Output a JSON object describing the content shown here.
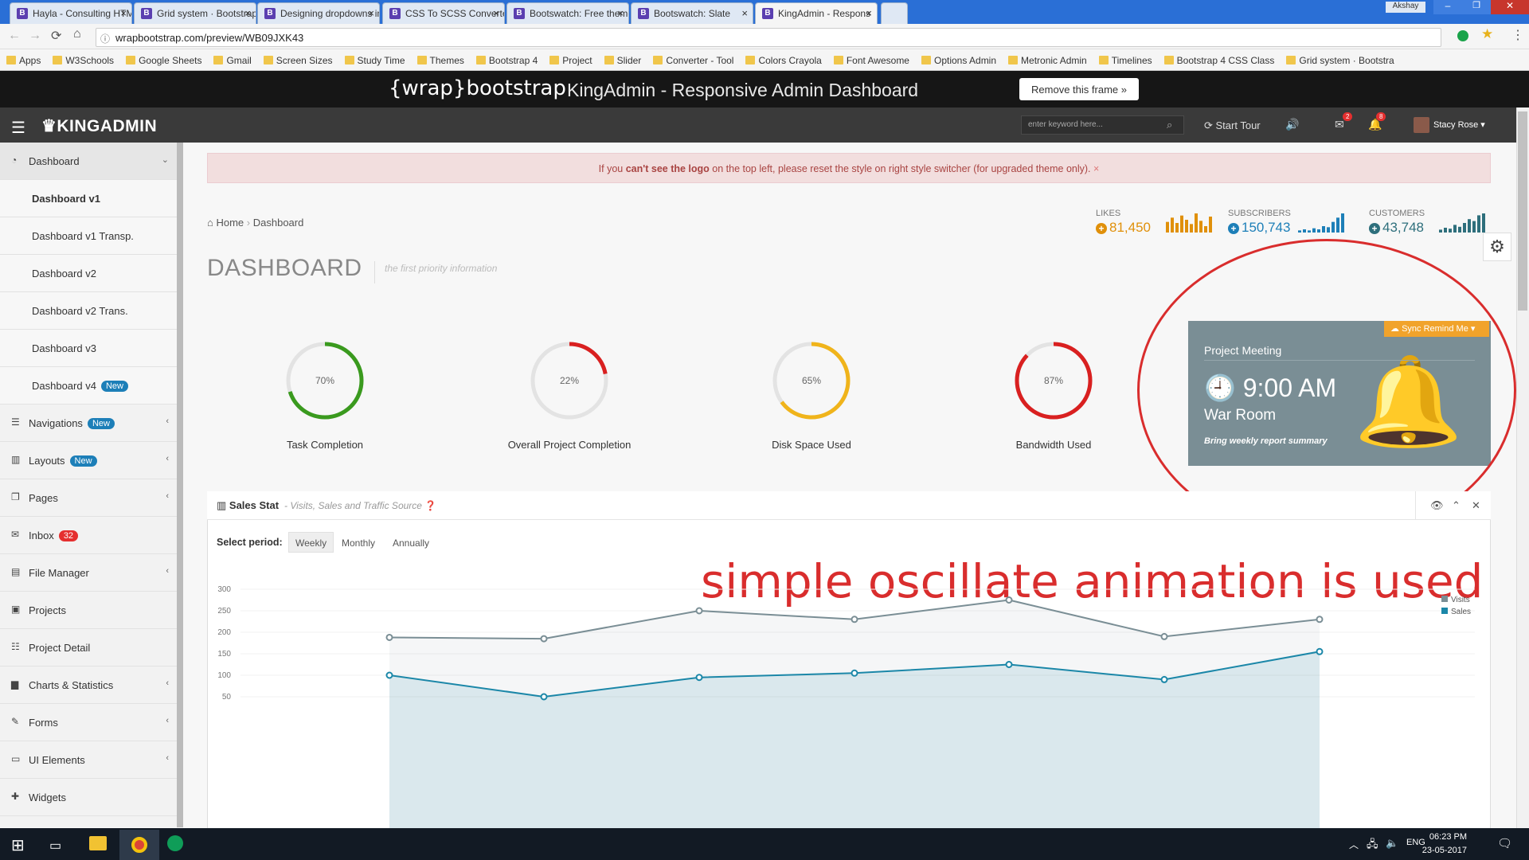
{
  "browser": {
    "tabs": [
      {
        "label": "Hayla - Consulting HTML",
        "active": false
      },
      {
        "label": "Grid system · Bootstrap",
        "active": false
      },
      {
        "label": "Designing dropdowns in",
        "active": false
      },
      {
        "label": "CSS To SCSS Converter -",
        "active": false
      },
      {
        "label": "Bootswatch: Free themes",
        "active": false
      },
      {
        "label": "Bootswatch: Slate",
        "active": false
      },
      {
        "label": "KingAdmin - Respons",
        "active": true
      }
    ],
    "window_user": "Akshay",
    "url": "wrapbootstrap.com/preview/WB09JXK43",
    "bookmarks": [
      "Apps",
      "W3Schools",
      "Google Sheets",
      "Gmail",
      "Screen Sizes",
      "Study Time",
      "Themes",
      "Bootstrap 4",
      "Project",
      "Slider",
      "Converter - Tool",
      "Colors Crayola",
      "Font Awesome",
      "Options Admin",
      "Metronic Admin",
      "Timelines",
      "Bootstrap 4 CSS Class",
      "Grid system · Bootstra"
    ]
  },
  "wrap_frame": {
    "logo": "{wrap}bootstrap",
    "title": "KingAdmin - Responsive Admin Dashboard",
    "remove_label": "Remove this frame »"
  },
  "header": {
    "brand": "KINGADMIN",
    "search_placeholder": "enter keyword here...",
    "start_tour": "Start Tour",
    "mail_count": "2",
    "notif_count": "8",
    "user_name": "Stacy Rose"
  },
  "sidebar": {
    "items": [
      {
        "label": "Dashboard",
        "icon": "tachometer-icon",
        "level": 1
      },
      {
        "label": "Dashboard v1",
        "level": 2,
        "active": true
      },
      {
        "label": "Dashboard v1 Transp.",
        "level": 2
      },
      {
        "label": "Dashboard v2",
        "level": 2
      },
      {
        "label": "Dashboard v2 Trans.",
        "level": 2
      },
      {
        "label": "Dashboard v3",
        "level": 2
      },
      {
        "label": "Dashboard v4",
        "level": 2,
        "badge": "New"
      },
      {
        "label": "Navigations",
        "icon": "bars-icon",
        "level": 1,
        "badge": "New"
      },
      {
        "label": "Layouts",
        "icon": "columns-icon",
        "level": 1,
        "badge": "New"
      },
      {
        "label": "Pages",
        "icon": "files-icon",
        "level": 1
      },
      {
        "label": "Inbox",
        "icon": "envelope-icon",
        "level": 1,
        "badge": "32"
      },
      {
        "label": "File Manager",
        "icon": "file-icon",
        "level": 1
      },
      {
        "label": "Projects",
        "icon": "briefcase-icon",
        "level": 1
      },
      {
        "label": "Project Detail",
        "icon": "list-icon",
        "level": 1
      },
      {
        "label": "Charts & Statistics",
        "icon": "bar-chart-icon",
        "level": 1
      },
      {
        "label": "Forms",
        "icon": "edit-icon",
        "level": 1
      },
      {
        "label": "UI Elements",
        "icon": "laptop-icon",
        "level": 1
      },
      {
        "label": "Widgets",
        "icon": "puzzle-icon",
        "level": 1
      }
    ]
  },
  "alert": {
    "prefix": "If you ",
    "strong": "can't see the logo",
    "suffix": " on the top left, please reset the style on right style switcher (for upgraded theme only). ",
    "close": "×"
  },
  "breadcrumb": {
    "home": "Home",
    "current": "Dashboard"
  },
  "page": {
    "title": "DASHBOARD",
    "subtitle": "the first priority information"
  },
  "top_stats": [
    {
      "label": "LIKES",
      "value": "81,450",
      "color": "#e0900a",
      "bars": [
        10,
        14,
        9,
        16,
        12,
        8,
        18,
        11,
        6,
        15
      ]
    },
    {
      "label": "SUBSCRIBERS",
      "value": "150,743",
      "color": "#1d7fb8",
      "bars": [
        2,
        3,
        2,
        4,
        3,
        6,
        5,
        10,
        14,
        18
      ]
    },
    {
      "label": "CUSTOMERS",
      "value": "43,748",
      "color": "#2e6f7c",
      "bars": [
        3,
        5,
        4,
        8,
        6,
        10,
        14,
        12,
        18,
        20
      ]
    }
  ],
  "donuts": [
    {
      "label": "Task Completion",
      "percent": 70,
      "color": "#3a9a1e"
    },
    {
      "label": "Overall Project Completion",
      "percent": 22,
      "color": "#d92020"
    },
    {
      "label": "Disk Space Used",
      "percent": 65,
      "color": "#f0b41b"
    },
    {
      "label": "Bandwidth Used",
      "percent": 87,
      "color": "#d92020"
    }
  ],
  "meeting": {
    "buttons": "Sync   Remind Me",
    "title": "Project Meeting",
    "time": "9:00 AM",
    "room": "War Room",
    "note": "Bring weekly report summary"
  },
  "annotation": "simple oscillate animation is used",
  "sales_panel": {
    "title": "Sales Stat",
    "subtitle": "- Visits, Sales and Traffic Source",
    "select_label": "Select period:",
    "periods": [
      "Weekly",
      "Monthly",
      "Annually"
    ],
    "active_period": "Weekly"
  },
  "chart_data": {
    "type": "line",
    "x": [
      1,
      2,
      3,
      4,
      5,
      6,
      7
    ],
    "ylim": [
      0,
      300
    ],
    "yticks": [
      50,
      100,
      150,
      200,
      250,
      300
    ],
    "series": [
      {
        "name": "Visits",
        "values": [
          188,
          185,
          250,
          230,
          275,
          190,
          230
        ],
        "color": "#7a8e95"
      },
      {
        "name": "Sales",
        "values": [
          100,
          50,
          95,
          105,
          125,
          90,
          155
        ],
        "color": "#1b87a8"
      }
    ],
    "legend": "top-right",
    "grid": true
  },
  "taskbar": {
    "lang": "ENG",
    "time": "06:23 PM",
    "date": "23-05-2017"
  }
}
